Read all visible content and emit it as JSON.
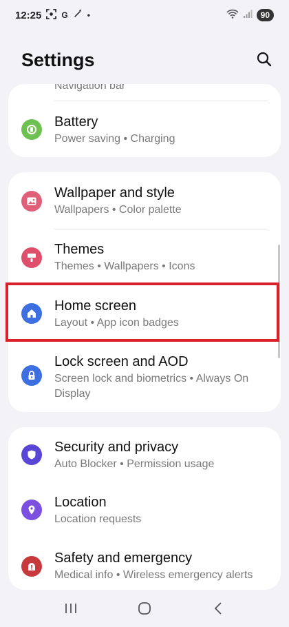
{
  "status_bar": {
    "time": "12:25",
    "indicators": [
      "scan-icon",
      "G",
      "magic-wand-icon",
      "•"
    ],
    "battery": "90"
  },
  "header": {
    "title": "Settings",
    "search_icon": "search-icon"
  },
  "cards": [
    {
      "items": [
        {
          "title": "",
          "subtitle": "Navigation bar",
          "icon": null
        },
        {
          "title": "Battery",
          "subtitle": "Power saving  •  Charging",
          "icon": "battery-icon",
          "color": "#6ec150"
        }
      ]
    },
    {
      "items": [
        {
          "title": "Wallpaper and style",
          "subtitle": "Wallpapers  •  Color palette",
          "icon": "image-icon",
          "color": "#e0607a"
        },
        {
          "title": "Themes",
          "subtitle": "Themes  •  Wallpapers  •  Icons",
          "icon": "brush-icon",
          "color": "#de4f6c"
        },
        {
          "title": "Home screen",
          "subtitle": "Layout  •  App icon badges",
          "icon": "home-icon",
          "color": "#3d6fe0"
        },
        {
          "title": "Lock screen and AOD",
          "subtitle": "Screen lock and biometrics  •  Always On Display",
          "icon": "lock-icon",
          "color": "#3d6fe0"
        }
      ]
    },
    {
      "items": [
        {
          "title": "Security and privacy",
          "subtitle": "Auto Blocker  •  Permission usage",
          "icon": "shield-icon",
          "color": "#5a46d6"
        },
        {
          "title": "Location",
          "subtitle": "Location requests",
          "icon": "location-pin-icon",
          "color": "#7b4fe0"
        },
        {
          "title": "Safety and emergency",
          "subtitle": "Medical info  •  Wireless emergency alerts",
          "icon": "emergency-icon",
          "color": "#c8393d"
        }
      ]
    }
  ],
  "highlighted_item": "Home screen",
  "nav_bar": [
    "recents-icon",
    "home-button-icon",
    "back-icon"
  ]
}
